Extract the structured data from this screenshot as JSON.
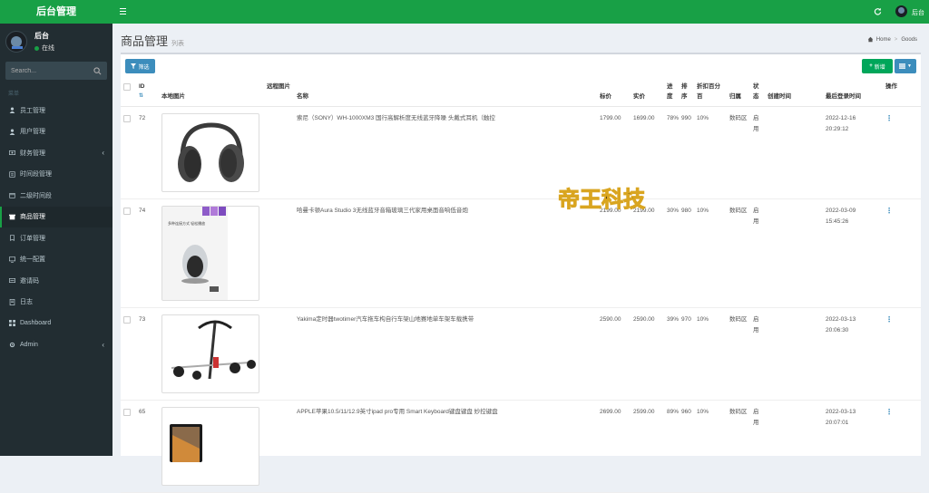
{
  "app": {
    "brand": "后台管理"
  },
  "user": {
    "name": "后台",
    "status": "在线"
  },
  "search": {
    "placeholder": "Search..."
  },
  "sidebar": {
    "section_label": "菜单",
    "items": [
      {
        "label": "员工管理",
        "icon": "user-icon",
        "active": false,
        "caret": false
      },
      {
        "label": "用户管理",
        "icon": "user-icon",
        "active": false,
        "caret": false
      },
      {
        "label": "财务管理",
        "icon": "money-icon",
        "active": false,
        "caret": true
      },
      {
        "label": "时间段管理",
        "icon": "list-icon",
        "active": false,
        "caret": false
      },
      {
        "label": "二级时间段",
        "icon": "calendar-icon",
        "active": false,
        "caret": false
      },
      {
        "label": "商品管理",
        "icon": "box-icon",
        "active": true,
        "caret": false
      },
      {
        "label": "订单管理",
        "icon": "order-icon",
        "active": false,
        "caret": false
      },
      {
        "label": "统一配置",
        "icon": "monitor-icon",
        "active": false,
        "caret": false
      },
      {
        "label": "邀请码",
        "icon": "code-icon",
        "active": false,
        "caret": false
      },
      {
        "label": "日志",
        "icon": "log-icon",
        "active": false,
        "caret": false
      },
      {
        "label": "Dashboard",
        "icon": "dashboard-icon",
        "active": false,
        "caret": false
      },
      {
        "label": "Admin",
        "icon": "admin-icon",
        "active": false,
        "caret": true
      }
    ]
  },
  "topbar": {
    "user_name": "后台"
  },
  "page": {
    "title": "商品管理",
    "subtitle": "列表"
  },
  "breadcrumb": {
    "home": "Home",
    "current": "Goods"
  },
  "toolbar": {
    "filter_label": "筛选",
    "new_label": "新增"
  },
  "table": {
    "headers": {
      "id": "ID",
      "local_image": "本地图片",
      "remote_image": "远程图片",
      "name": "名称",
      "list_price": "标价",
      "price": "实价",
      "progress": "进度",
      "sort": "排序",
      "discount": "折扣百分百",
      "category": "归属",
      "status": "状态",
      "created": "创建时间",
      "last_login": "最后登录时间",
      "action": "操作"
    },
    "rows": [
      {
        "id": "72",
        "name": "索尼（SONY）WH-1000XM3 国行高解析度无线蓝牙降噪 头戴式耳机（触控",
        "list_price": "1799.00",
        "price": "1699.00",
        "progress": "78%",
        "sort": "990",
        "discount": "10%",
        "category": "数码区",
        "status": "启用",
        "created": "",
        "last_login_date": "2022-12-16",
        "last_login_time": "20:29:12",
        "image": "headphones"
      },
      {
        "id": "74",
        "name": "哈曼卡顿Aura Studio 3无线蓝牙音箱玻璃三代家用桌面音响低音炮",
        "list_price": "2199.00",
        "price": "2199.00",
        "progress": "30%",
        "sort": "980",
        "discount": "10%",
        "category": "数码区",
        "status": "启用",
        "created": "",
        "last_login_date": "2022-03-09",
        "last_login_time": "15:45:26",
        "image": "speaker"
      },
      {
        "id": "73",
        "name": "Yakima定时器twotimer汽车拖车构自行车架山地赛地单车架车载携带",
        "list_price": "2590.00",
        "price": "2590.00",
        "progress": "39%",
        "sort": "970",
        "discount": "10%",
        "category": "数码区",
        "status": "启用",
        "created": "",
        "last_login_date": "2022-03-13",
        "last_login_time": "20:06:30",
        "image": "bikerack"
      },
      {
        "id": "65",
        "name": "APPLE苹果10.5/11/12.9英寸ipad pro专用 Smart Keyboard键盘键盘 妙控键盘",
        "list_price": "2699.00",
        "price": "2599.00",
        "progress": "89%",
        "sort": "960",
        "discount": "10%",
        "category": "数码区",
        "status": "启用",
        "created": "",
        "last_login_date": "2022-03-13",
        "last_login_time": "20:07:01",
        "image": "ipad"
      }
    ]
  },
  "speaker_ad_text": "多种连接方式 轻松播放",
  "watermark_text": "帝王科技",
  "colors": {
    "green": "#18a046",
    "sidebar": "#222d32",
    "blue": "#3c8dbc"
  }
}
